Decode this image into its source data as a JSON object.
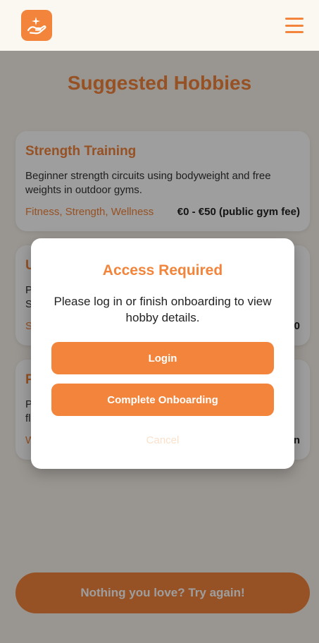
{
  "header": {
    "logo_icon": "hand-sparkle-icon",
    "menu_icon": "hamburger-menu-icon"
  },
  "page": {
    "title": "Suggested Hobbies"
  },
  "cards": [
    {
      "title": "Strength Training",
      "description": "Beginner strength circuits using bodyweight and free weights in outdoor gyms.",
      "tags": "Fitness, Strength, Wellness",
      "price": "€0 - €50 (public gym fee)"
    },
    {
      "title": "U",
      "description": "P\nS",
      "tags": "S",
      "price": "0"
    },
    {
      "title": "P",
      "description": "P\nfl",
      "tags": "W",
      "price": "ion"
    }
  ],
  "retry_button": {
    "label": "Nothing you love? Try again!"
  },
  "modal": {
    "title": "Access Required",
    "message": "Please log in or finish onboarding to view hobby details.",
    "login_label": "Login",
    "onboarding_label": "Complete Onboarding",
    "cancel_label": "Cancel"
  },
  "colors": {
    "accent": "#f2843b",
    "background": "#f7f1ea",
    "header": "#fbf7f1"
  }
}
